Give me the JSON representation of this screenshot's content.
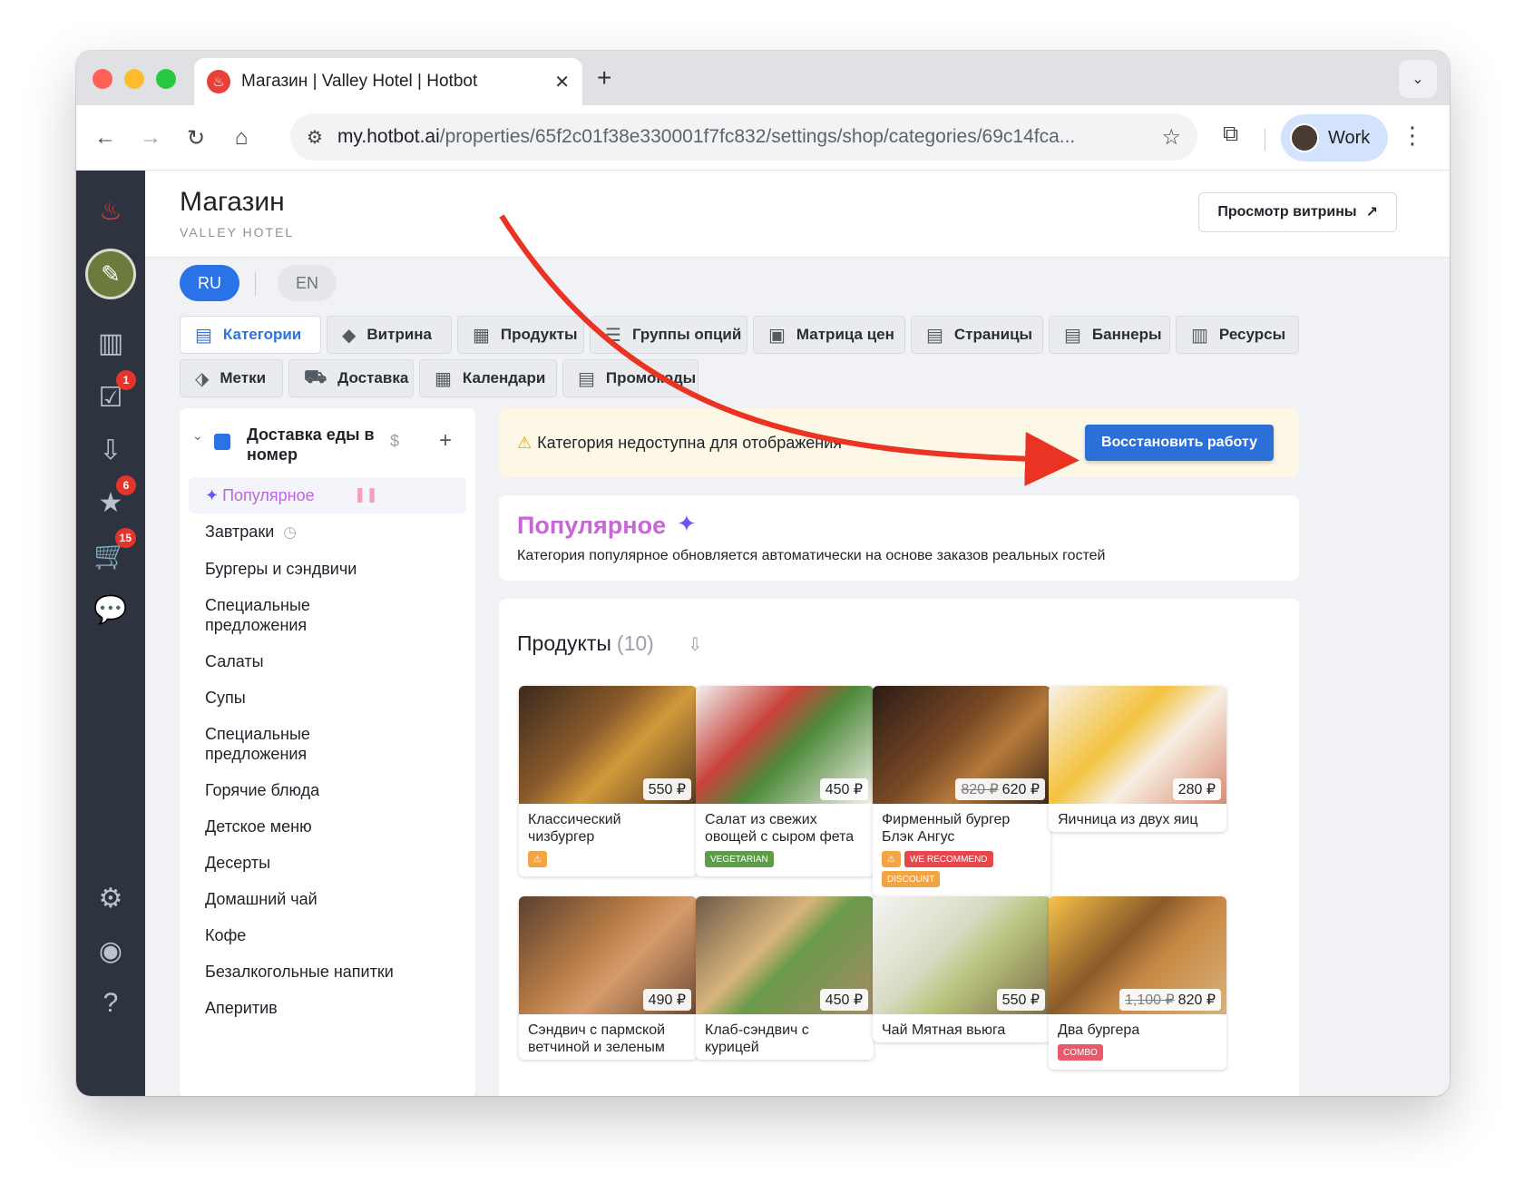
{
  "browser": {
    "tab_title": "Магазин | Valley Hotel | Hotbot",
    "url_host": "my.hotbot.ai",
    "url_path": "/properties/65f2c01f38e330001f7fc832/settings/shop/categories/69c14fca...",
    "profile_label": "Work"
  },
  "header": {
    "title": "Магазин",
    "subtitle": "VALLEY HOTEL",
    "preview_label": "Просмотр витрины"
  },
  "languages": {
    "ru": "RU",
    "en": "EN"
  },
  "rail": {
    "badges": {
      "tasks": "1",
      "reviews": "6",
      "orders": "15"
    }
  },
  "nav_tabs": [
    {
      "label": "Категории",
      "icon": "store-icon"
    },
    {
      "label": "Витрина",
      "icon": "showcase-icon"
    },
    {
      "label": "Продукты",
      "icon": "products-icon"
    },
    {
      "label": "Группы опций",
      "icon": "options-icon"
    },
    {
      "label": "Матрица цен",
      "icon": "matrix-icon"
    },
    {
      "label": "Страницы",
      "icon": "pages-icon"
    },
    {
      "label": "Баннеры",
      "icon": "banners-icon"
    },
    {
      "label": "Ресурсы",
      "icon": "resources-icon"
    },
    {
      "label": "Метки",
      "icon": "tag-icon"
    },
    {
      "label": "Доставка",
      "icon": "truck-icon"
    },
    {
      "label": "Календари",
      "icon": "calendar-icon"
    },
    {
      "label": "Промокоды",
      "icon": "promo-icon"
    }
  ],
  "sidebar": {
    "title": "Доставка еды в номер",
    "items": [
      "Популярное",
      "Завтраки",
      "Бургеры и сэндвичи",
      "Специальные предложения",
      "Салаты",
      "Супы",
      "Специальные предложения",
      "Горячие блюда",
      "Детское меню",
      "Десерты",
      "Домашний чай",
      "Кофе",
      "Безалкогольные напитки",
      "Аперитив"
    ]
  },
  "alert": {
    "text": "Категория недоступна для отображения",
    "button": "Восстановить работу"
  },
  "popular": {
    "title": "Популярное",
    "description": "Категория популярное обновляется автоматически на основе заказов реальных гостей"
  },
  "products": {
    "heading": "Продукты",
    "count": "(10)",
    "items": [
      {
        "name": "Классический чизбургер",
        "price": "550 ₽",
        "old_price": "",
        "tags": [
          {
            "label": "",
            "color": "#f1a545"
          }
        ]
      },
      {
        "name": "Салат из свежих овощей с сыром фета",
        "price": "450 ₽",
        "old_price": "",
        "tags": [
          {
            "label": "VEGETARIAN",
            "color": "#5d9c4a"
          }
        ]
      },
      {
        "name": "Фирменный бургер Блэк Ангус",
        "price": "620 ₽",
        "old_price": "820 ₽",
        "tags": [
          {
            "label": "",
            "color": "#f1a545"
          },
          {
            "label": "WE RECOMMEND",
            "color": "#e5474b"
          },
          {
            "label": "DISCOUNT",
            "color": "#f1a545"
          }
        ]
      },
      {
        "name": "Яичница из двух яиц",
        "price": "280 ₽",
        "old_price": "",
        "tags": []
      },
      {
        "name": "Сэндвич с пармской ветчиной и зеленым",
        "price": "490 ₽",
        "old_price": "",
        "tags": []
      },
      {
        "name": "Клаб-сэндвич с курицей",
        "price": "450 ₽",
        "old_price": "",
        "tags": []
      },
      {
        "name": "Чай Мятная вьюга",
        "price": "550 ₽",
        "old_price": "",
        "tags": []
      },
      {
        "name": "Два бургера",
        "price": "820 ₽",
        "old_price": "1,100 ₽",
        "tags": [
          {
            "label": "COMBO",
            "color": "#e85a6a"
          }
        ]
      }
    ]
  }
}
